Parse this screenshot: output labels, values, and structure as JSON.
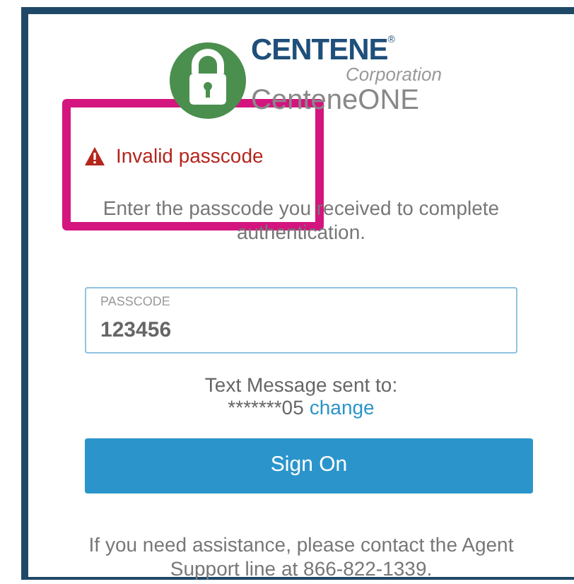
{
  "logo": {
    "brand": "CENTENE",
    "registered": "®",
    "subtitle": "Corporation",
    "product": "CenteneONE"
  },
  "error": {
    "message": "Invalid passcode"
  },
  "instructions": "Enter the passcode you received to complete authentication.",
  "passcode_field": {
    "label": "PASSCODE",
    "value": "123456"
  },
  "sent_to": {
    "label": "Text Message sent to:",
    "number": "*******05",
    "link": "change"
  },
  "sign_on_button": "Sign On",
  "help_text": "If you need assistance, please contact the Agent Support line at 866-822-1339."
}
